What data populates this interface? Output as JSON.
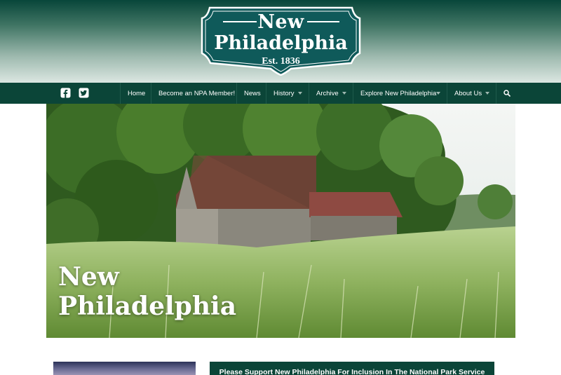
{
  "logo": {
    "line1": "New",
    "line2": "Philadelphia",
    "established": "Est. 1836"
  },
  "social": [
    {
      "icon": "facebook-icon",
      "glyph": "f"
    },
    {
      "icon": "twitter-icon",
      "glyph": "t"
    }
  ],
  "nav": {
    "items": [
      {
        "label": "Home",
        "has_dropdown": false
      },
      {
        "label": "Become an NPA Member!",
        "has_dropdown": false
      },
      {
        "label": "News",
        "has_dropdown": false
      },
      {
        "label": "History",
        "has_dropdown": true
      },
      {
        "label": "Archive",
        "has_dropdown": true
      },
      {
        "label": "Explore New Philadelphia",
        "has_dropdown": true
      },
      {
        "label": "About Us",
        "has_dropdown": true
      }
    ],
    "search_icon": "search-icon"
  },
  "hero": {
    "title": "New\nPhiladelphia"
  },
  "callout": {
    "text": "Please Support New Philadelphia For Inclusion In The National Park Service"
  },
  "colors": {
    "brand_green": "#0b4538",
    "logo_teal": "#0f5a5a"
  }
}
